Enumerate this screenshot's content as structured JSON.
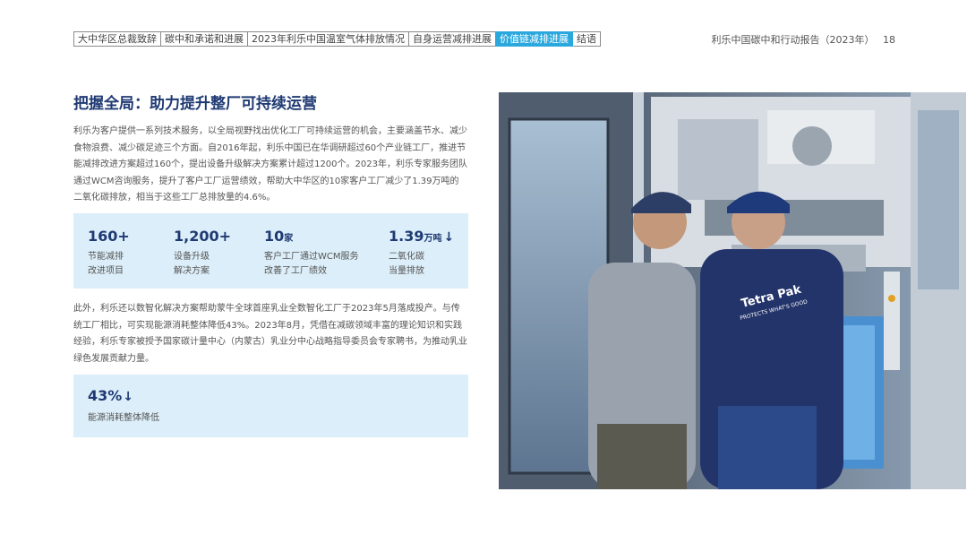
{
  "nav": {
    "tabs": [
      {
        "label": "大中华区总裁致辞",
        "active": false
      },
      {
        "label": "碳中和承诺和进展",
        "active": false
      },
      {
        "label": "2023年利乐中国温室气体排放情况",
        "active": false
      },
      {
        "label": "自身运营减排进展",
        "active": false
      },
      {
        "label": "价值链减排进展",
        "active": true
      },
      {
        "label": "结语",
        "active": false
      }
    ]
  },
  "header": {
    "report_title": "利乐中国碳中和行动报告（2023年）",
    "page_number": "18"
  },
  "section": {
    "title": "把握全局：助力提升整厂可持续运营",
    "paragraph1": "利乐为客户提供一系列技术服务，以全局视野找出优化工厂可持续运营的机会，主要涵盖节水、减少食物浪费、减少碳足迹三个方面。自2016年起，利乐中国已在华调研超过60个产业链工厂，推进节能减排改进方案超过160个，提出设备升级解决方案累计超过1200个。2023年，利乐专家服务团队通过WCM咨询服务，提升了客户工厂运营绩效，帮助大中华区的10家客户工厂减少了1.39万吨的二氧化碳排放，相当于这些工厂总排放量的4.6%。",
    "paragraph2": "此外，利乐还以数智化解决方案帮助蒙牛全球首座乳业全数智化工厂于2023年5月落成投产。与传统工厂相比，可实现能源消耗整体降低43%。2023年8月，凭借在减碳领域丰富的理论知识和实践经验，利乐专家被授予国家碳计量中心（内蒙古）乳业分中心战略指导委员会专家聘书，为推动乳业绿色发展贡献力量。"
  },
  "stats": [
    {
      "value": "160+",
      "unit": "",
      "arrow": "",
      "desc_line1": "节能减排",
      "desc_line2": "改进项目"
    },
    {
      "value": "1,200+",
      "unit": "",
      "arrow": "",
      "desc_line1": "设备升级",
      "desc_line2": "解决方案"
    },
    {
      "value": "10",
      "unit": "家",
      "arrow": "",
      "desc_line1": "客户工厂通过WCM服务",
      "desc_line2": "改善了工厂绩效"
    },
    {
      "value": "1.39",
      "unit": "万吨",
      "arrow": "↓",
      "desc_line1": "二氧化碳",
      "desc_line2": "当量排放"
    }
  ],
  "stat_energy": {
    "value": "43%",
    "arrow": "↓",
    "desc": "能源消耗整体降低"
  },
  "photo": {
    "shirt_logo": "Tetra Pak",
    "shirt_tagline": "PROTECTS WHAT'S GOOD"
  },
  "colors": {
    "accent": "#2aa8de",
    "title": "#1f3a73",
    "stat_bg": "#dceef9"
  }
}
